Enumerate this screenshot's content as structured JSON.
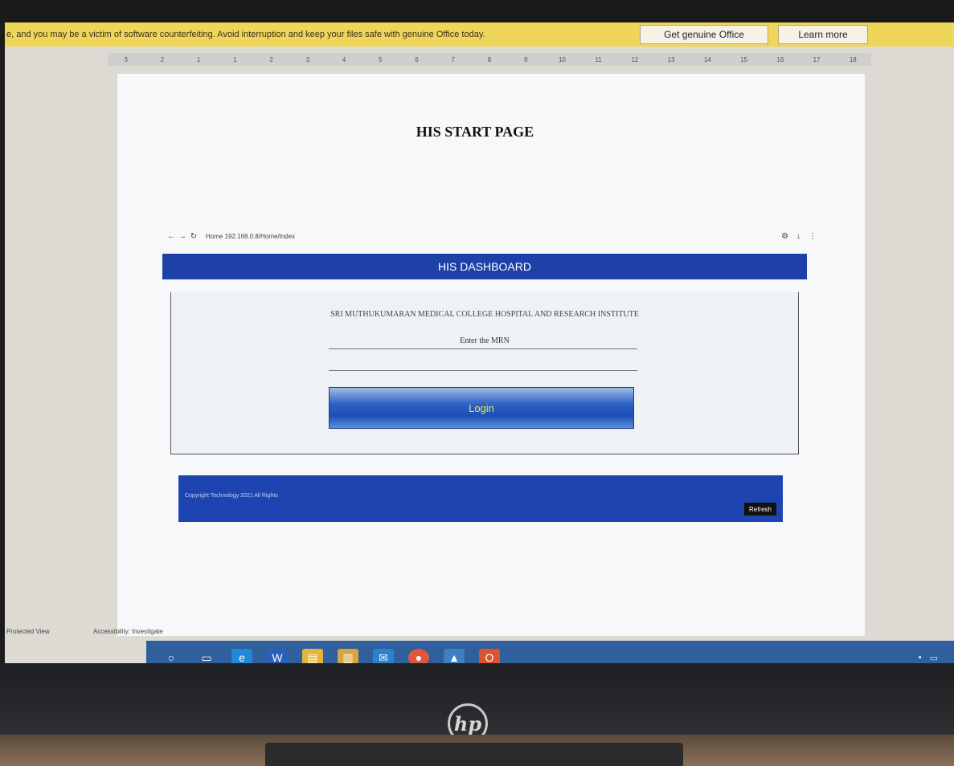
{
  "office_banner": {
    "message": "e, and you may be a victim of software counterfeiting. Avoid interruption and keep your files safe with genuine Office today.",
    "get_genuine": "Get genuine Office",
    "learn_more": "Learn more"
  },
  "ruler": {
    "ticks": [
      "3",
      "2",
      "1",
      "1",
      "2",
      "3",
      "4",
      "5",
      "6",
      "7",
      "8",
      "9",
      "10",
      "11",
      "12",
      "13",
      "14",
      "15",
      "16",
      "17",
      "18"
    ]
  },
  "document": {
    "title": "HIS START PAGE"
  },
  "browser": {
    "address": "Home  192.168.0.8/Home/Index"
  },
  "dashboard": {
    "header": "HIS DASHBOARD",
    "institute": "SRI MUTHUKUMARAN MEDICAL COLLEGE HOSPITAL AND RESEARCH INSTITUTE",
    "mrn_label": "Enter the MRN",
    "mrn_value": "",
    "login_label": "Login",
    "footer_text": "Copyright Technology 2021 All Rights",
    "footer_button": "Refresh"
  },
  "statusbar": {
    "left": "Protected View",
    "mid": "Accessibility: Investigate"
  },
  "taskbar": {
    "icons": [
      "windows-search-circle-icon",
      "task-view-icon",
      "edge-icon",
      "word-icon",
      "file-explorer-icon",
      "folder-icon",
      "mail-icon",
      "chrome-icon",
      "photos-icon",
      "office-icon"
    ]
  },
  "colors": {
    "banner": "#efd65a",
    "dashboard_blue": "#1d41a8",
    "login_text": "#f1e34a",
    "taskbar": "#2f5f9c"
  }
}
